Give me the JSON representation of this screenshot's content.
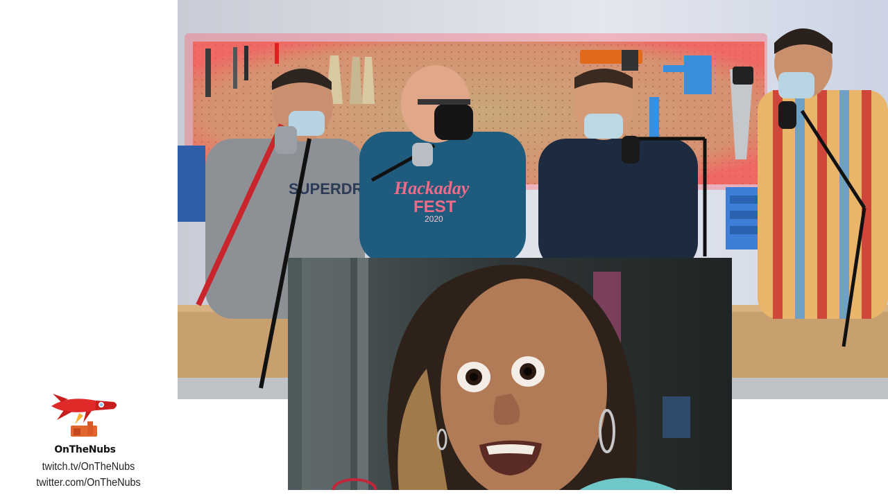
{
  "branding": {
    "logo_icon": "red-rocket-icon",
    "name": "OnTheNubs",
    "twitch": "twitch.tv/OnTheNubs",
    "twitter": "twitter.com/OnTheNubs"
  },
  "main_feed": {
    "scene": "studio-webcam",
    "shirt_text_line1": "Hackaday",
    "shirt_text_line2": "FEST",
    "shirt_text_line3": "2020"
  },
  "inset_video": {
    "scene": "reaction-video"
  },
  "colors": {
    "accent_red": "#e02a2a",
    "pegboard": "#c7a57a",
    "led_glow": "#ff4e57"
  }
}
